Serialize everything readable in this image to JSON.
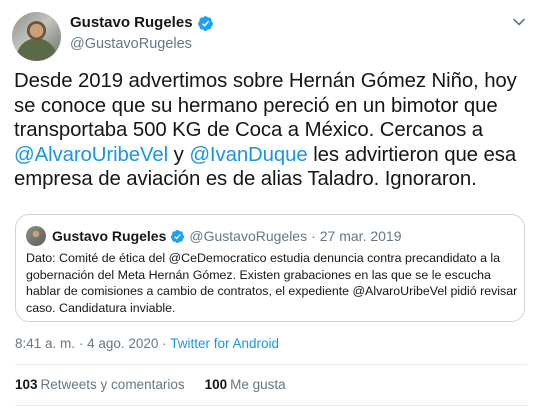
{
  "author": {
    "name": "Gustavo Rugeles",
    "handle": "@GustavoRugeles"
  },
  "tweet": {
    "text_parts": {
      "p1": "Desde 2019 advertimos sobre Hernán Gómez Niño, hoy se conoce que su hermano pereció en un bimotor que transportaba 500 KG de Coca a México. Cercanos a ",
      "m1": "@AlvaroUribeVel",
      "p2": " y ",
      "m2": "@IvanDuque",
      "p3": " les advirtieron que esa empresa de aviación es de alias Taladro. Ignoraron."
    }
  },
  "quoted": {
    "name": "Gustavo Rugeles",
    "handle": "@GustavoRugeles",
    "separator": "·",
    "date": "27 mar. 2019",
    "text": "Dato: Comité de ética del @CeDemocratico estudia denuncia contra precandidato a la gobernación del Meta Hernán Gómez. Existen grabaciones en las que se le escucha hablar de comisiones a cambio de contratos, el expediente @AlvaroUribeVel pidió revisar caso. Candidatura inviable."
  },
  "meta": {
    "time": "8:41 a. m.",
    "separator1": "·",
    "date": "4 ago. 2020",
    "separator2": "·",
    "source": "Twitter for Android"
  },
  "stats": {
    "retweets_count": "103",
    "retweets_label": "Retweets y comentarios",
    "likes_count": "100",
    "likes_label": "Me gusta"
  },
  "colors": {
    "link": "#1b95e0",
    "verified": "#1da1f2",
    "secondary_text": "#657786",
    "border": "#ccd6dd"
  },
  "icons": {
    "verified": "verified-badge-icon",
    "caret": "chevron-down-icon"
  }
}
